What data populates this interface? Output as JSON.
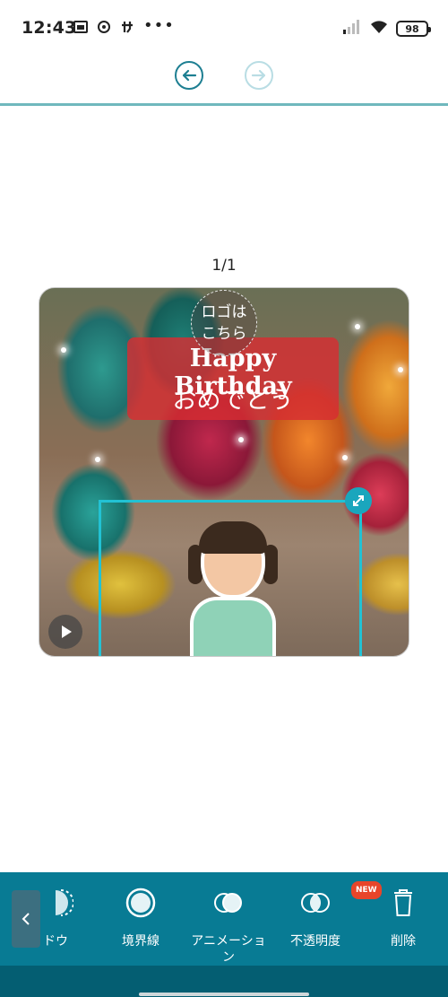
{
  "status": {
    "time": "12:43",
    "battery": "98"
  },
  "editor": {
    "page_counter": "1/1"
  },
  "canvas": {
    "logo_placeholder_line1": "ロゴは",
    "logo_placeholder_line2": "こちら",
    "greeting_en": "Happy Birthday",
    "greeting_ja": "おめでとう"
  },
  "toolbar": {
    "items": [
      {
        "label": "ドウ",
        "icon": "shadow-icon"
      },
      {
        "label": "境界線",
        "icon": "border-icon"
      },
      {
        "label": "アニメーショ ン",
        "icon": "animation-icon"
      },
      {
        "label": "不透明度",
        "icon": "opacity-icon",
        "badge": "NEW"
      },
      {
        "label": "削除",
        "icon": "trash-icon"
      }
    ]
  },
  "colors": {
    "accent": "#087b94",
    "selection": "#22c2d4",
    "greeting_bg": "#d72d32"
  }
}
